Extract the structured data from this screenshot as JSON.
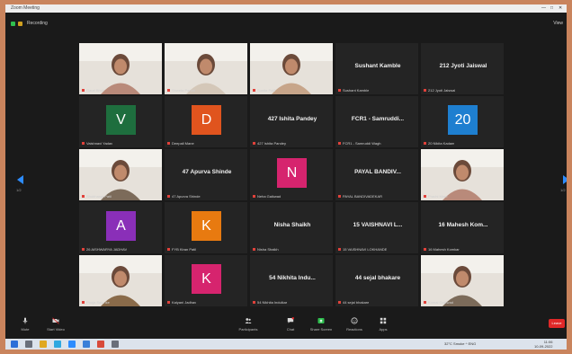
{
  "titlebar": {
    "title": "Zoom Meeting",
    "controls": [
      "—",
      "□",
      "✕"
    ]
  },
  "topbar": {
    "recording_label": "Recording",
    "view_label": "View"
  },
  "tiles": [
    {
      "kind": "video",
      "caption": "Gauri Bhoir"
    },
    {
      "kind": "video",
      "caption": "Shweta Pandit",
      "active": true
    },
    {
      "kind": "video",
      "caption": "Sunita Patil"
    },
    {
      "kind": "name",
      "name": "Sushant Kamble",
      "caption": "Sushant Kamble"
    },
    {
      "kind": "name",
      "name": "212 Jyoti Jaiswal",
      "caption": "212 Jyoti Jaiswal"
    },
    {
      "kind": "avatar",
      "letter": "V",
      "color": "#1e6e3e",
      "caption": "Vaishnavi Yadav"
    },
    {
      "kind": "avatar",
      "letter": "D",
      "color": "#e0541e",
      "caption": "Deepali Mane"
    },
    {
      "kind": "name",
      "name": "427 Ishita Pandey",
      "caption": "427 Ishita Pandey"
    },
    {
      "kind": "name",
      "name": "FCR1 - Samruddi...",
      "caption": "FCR1 - Samruddi Wagh"
    },
    {
      "kind": "avatar",
      "letter": "20",
      "color": "#1e7fd0",
      "caption": "20 Nikita Kadam"
    },
    {
      "kind": "video",
      "caption": "Shubhangi Patil"
    },
    {
      "kind": "name",
      "name": "47 Apurva Shinde",
      "caption": "47 Apurva Shinde"
    },
    {
      "kind": "avatar",
      "letter": "N",
      "color": "#d6246e",
      "caption": "Neha Gaikwad"
    },
    {
      "kind": "name",
      "name": "PAYAL BANDIV...",
      "caption": "PAYAL BANDIVADEKAR"
    },
    {
      "kind": "video",
      "caption": "Prachi More"
    },
    {
      "kind": "avatar",
      "letter": "A",
      "color": "#8a2fb8",
      "caption": "26 AISHWARYA JADHAV"
    },
    {
      "kind": "avatar",
      "letter": "K",
      "color": "#e87a10",
      "caption": "FYB Kiran Patil"
    },
    {
      "kind": "name",
      "name": "Nisha Shaikh",
      "caption": "Nisha Shaikh"
    },
    {
      "kind": "name",
      "name": "15 VAISHNAVI L...",
      "caption": "15 VAISHNAVI LOKHANDE"
    },
    {
      "kind": "name",
      "name": "16 Mahesh Kom...",
      "caption": "16 Mahesh Komkar"
    },
    {
      "kind": "video",
      "caption": "Pooja Salunke"
    },
    {
      "kind": "avatar",
      "letter": "K",
      "color": "#d6246e",
      "caption": "Kalyani Jadhav"
    },
    {
      "kind": "name",
      "name": "54 Nikhita Indu...",
      "caption": "54 Nikhita Indulkar"
    },
    {
      "kind": "name",
      "name": "44 sejal bhakare",
      "caption": "44 sejal bhakare"
    },
    {
      "kind": "video",
      "caption": "Komal Gaikwad"
    }
  ],
  "pager": {
    "left": "1/2",
    "right": "1/2"
  },
  "controls": [
    {
      "label": "Mute",
      "icon": "mic-icon"
    },
    {
      "label": "Start Video",
      "icon": "video-icon"
    },
    {
      "label": "Participants",
      "icon": "participants-icon"
    },
    {
      "label": "Chat",
      "icon": "chat-icon"
    },
    {
      "label": "Share Screen",
      "icon": "share-screen-icon"
    },
    {
      "label": "Reactions",
      "icon": "reactions-icon"
    },
    {
      "label": "Apps",
      "icon": "apps-icon"
    }
  ],
  "leave_label": "Leave",
  "taskbar": {
    "tray_text": "32°C Smoke  ^  ENG",
    "time": "11:06",
    "date": "10-09-2022"
  },
  "colors": {
    "active_speaker": "#c6d84a",
    "leave": "#e02828",
    "accent": "#2d8cff"
  }
}
